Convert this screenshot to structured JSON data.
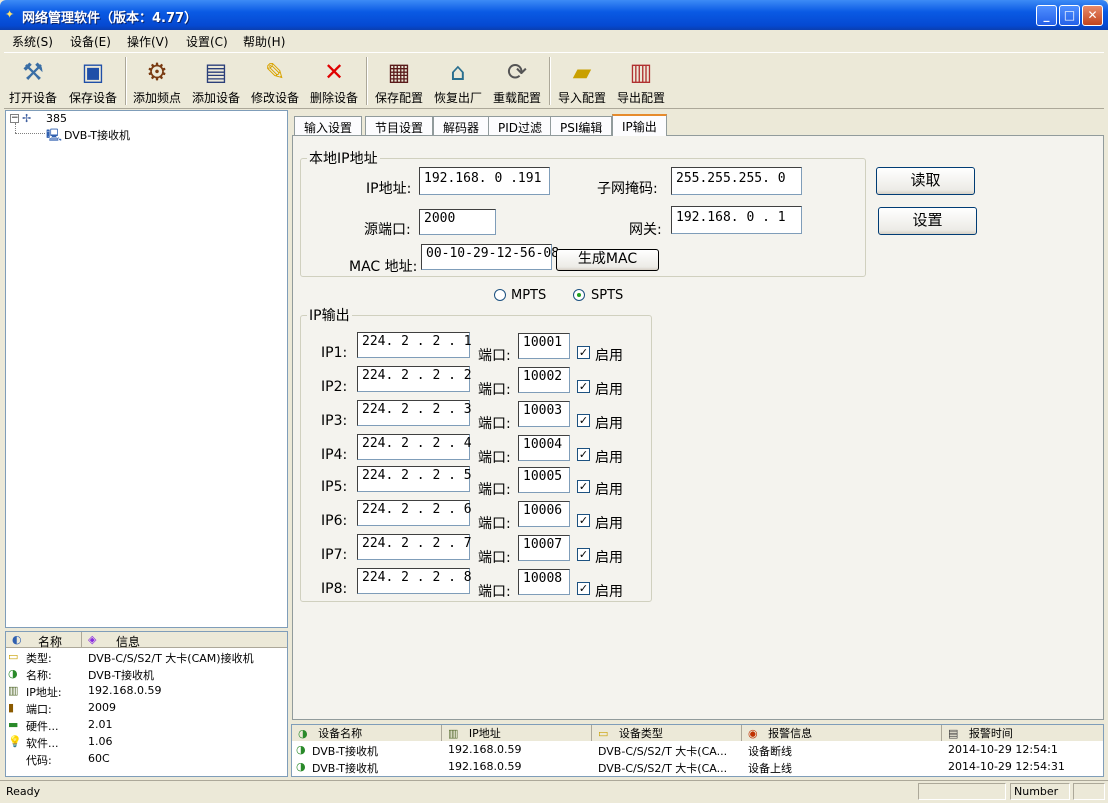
{
  "window": {
    "title": "网络管理软件（版本：4.77）"
  },
  "menu": [
    "系统(S)",
    "设备(E)",
    "操作(V)",
    "设置(C)",
    "帮助(H)"
  ],
  "toolbar": [
    {
      "label": "打开设备",
      "icon": "open-device-icon"
    },
    {
      "label": "保存设备",
      "icon": "save-device-icon"
    },
    {
      "label": "添加频点",
      "icon": "add-frequency-icon"
    },
    {
      "label": "添加设备",
      "icon": "add-device-icon"
    },
    {
      "label": "修改设备",
      "icon": "edit-device-icon"
    },
    {
      "label": "删除设备",
      "icon": "delete-device-icon"
    },
    {
      "label": "保存配置",
      "icon": "save-config-icon"
    },
    {
      "label": "恢复出厂",
      "icon": "factory-reset-icon"
    },
    {
      "label": "重载配置",
      "icon": "reload-config-icon"
    },
    {
      "label": "导入配置",
      "icon": "import-config-icon"
    },
    {
      "label": "导出配置",
      "icon": "export-config-icon"
    }
  ],
  "tree": {
    "root": "385",
    "child": "DVB-T接收机"
  },
  "info": {
    "header_name": "名称",
    "header_info": "信息",
    "rows": [
      {
        "key": "类型:",
        "value": "DVB-C/S/S2/T 大卡(CAM)接收机"
      },
      {
        "key": "名称:",
        "value": "DVB-T接收机"
      },
      {
        "key": "IP地址:",
        "value": "192.168.0.59"
      },
      {
        "key": "端口:",
        "value": "2009"
      },
      {
        "key": "硬件...",
        "value": "2.01"
      },
      {
        "key": "软件...",
        "value": "1.06"
      },
      {
        "key": "代码:",
        "value": "60C"
      }
    ]
  },
  "tabs": [
    "输入设置",
    "节目设置",
    "解码器",
    "PID过滤",
    "PSI编辑",
    "IP输出"
  ],
  "local_ip": {
    "legend": "本地IP地址",
    "ip_label": "IP地址:",
    "ip": "192.168. 0 .191",
    "mask_label": "子网掩码:",
    "mask": "255.255.255. 0",
    "port_label": "源端口:",
    "port": "2000",
    "gateway_label": "网关:",
    "gateway": "192.168. 0 . 1",
    "mac_label": "MAC 地址:",
    "mac": "00-10-29-12-56-08",
    "gen_mac": "生成MAC"
  },
  "buttons": {
    "read": "读取",
    "set": "设置"
  },
  "mode": {
    "mpts": "MPTS",
    "spts": "SPTS",
    "selected": "SPTS"
  },
  "ip_output": {
    "legend": "IP输出",
    "port_label": "端口:",
    "enable_label": "启用",
    "rows": [
      {
        "label": "IP1:",
        "ip": "224. 2 . 2 . 1",
        "port": "10001",
        "enabled": true
      },
      {
        "label": "IP2:",
        "ip": "224. 2 . 2 . 2",
        "port": "10002",
        "enabled": true
      },
      {
        "label": "IP3:",
        "ip": "224. 2 . 2 . 3",
        "port": "10003",
        "enabled": true
      },
      {
        "label": "IP4:",
        "ip": "224. 2 . 2 . 4",
        "port": "10004",
        "enabled": true
      },
      {
        "label": "IP5:",
        "ip": "224. 2 . 2 . 5",
        "port": "10005",
        "enabled": true
      },
      {
        "label": "IP6:",
        "ip": "224. 2 . 2 . 6",
        "port": "10006",
        "enabled": true
      },
      {
        "label": "IP7:",
        "ip": "224. 2 . 2 . 7",
        "port": "10007",
        "enabled": true
      },
      {
        "label": "IP8:",
        "ip": "224. 2 . 2 . 8",
        "port": "10008",
        "enabled": true
      }
    ]
  },
  "alarm": {
    "columns": [
      "设备名称",
      "IP地址",
      "设备类型",
      "报警信息",
      "报警时间"
    ],
    "rows": [
      [
        "DVB-T接收机",
        "192.168.0.59",
        "DVB-C/S/S2/T 大卡(CA...",
        "设备断线",
        "2014-10-29 12:54:1"
      ],
      [
        "DVB-T接收机",
        "192.168.0.59",
        "DVB-C/S/S2/T 大卡(CA...",
        "设备上线",
        "2014-10-29 12:54:31"
      ]
    ]
  },
  "status": {
    "left": "Ready",
    "number": "Number"
  }
}
